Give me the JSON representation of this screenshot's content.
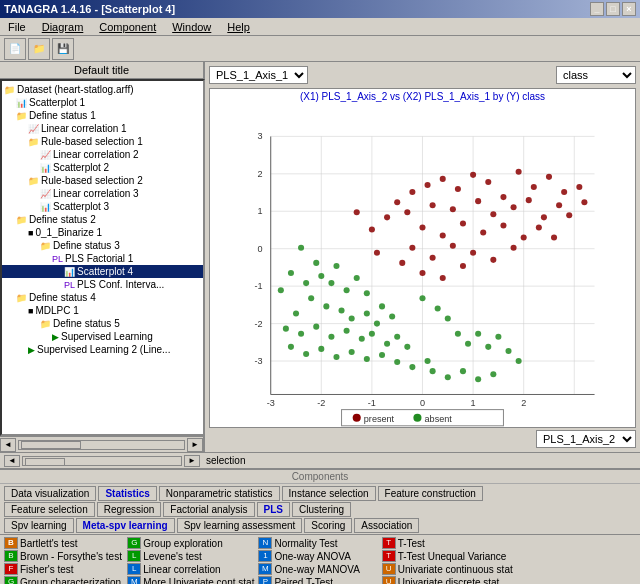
{
  "titleBar": {
    "title": "TANAGRA 1.4.16 - [Scatterplot 4]",
    "buttons": [
      "_",
      "□",
      "×"
    ]
  },
  "menuBar": {
    "items": [
      "File",
      "Diagram",
      "Component",
      "Window",
      "Help"
    ]
  },
  "toolbar": {
    "buttons": [
      "📄",
      "📁",
      "💾",
      "⚙"
    ]
  },
  "leftPanel": {
    "defaultTitle": "Default title",
    "tree": [
      {
        "indent": 0,
        "icon": "📁",
        "label": "Dataset (heart-statlog.arff)",
        "type": "dataset"
      },
      {
        "indent": 1,
        "icon": "📊",
        "label": "Scatterplot 1",
        "type": "plot"
      },
      {
        "indent": 1,
        "icon": "📁",
        "label": "Define status 1",
        "type": "folder"
      },
      {
        "indent": 2,
        "icon": "📈",
        "label": "Linear correlation 1",
        "type": "stat"
      },
      {
        "indent": 2,
        "icon": "📁",
        "label": "Rule-based selection 1",
        "type": "folder"
      },
      {
        "indent": 3,
        "icon": "📈",
        "label": "Linear correlation 2",
        "type": "stat"
      },
      {
        "indent": 3,
        "icon": "📊",
        "label": "Scatterplot 2",
        "type": "plot"
      },
      {
        "indent": 2,
        "icon": "📁",
        "label": "Rule-based selection 2",
        "type": "folder"
      },
      {
        "indent": 3,
        "icon": "📈",
        "label": "Linear correlation 3",
        "type": "stat"
      },
      {
        "indent": 3,
        "icon": "📊",
        "label": "Scatterplot 3",
        "type": "plot"
      },
      {
        "indent": 1,
        "icon": "📁",
        "label": "Define status 2",
        "type": "folder"
      },
      {
        "indent": 2,
        "icon": "📊",
        "label": "0_1_Binarize 1",
        "type": "plot"
      },
      {
        "indent": 3,
        "icon": "📁",
        "label": "Define status 3",
        "type": "folder"
      },
      {
        "indent": 4,
        "icon": "📊",
        "label": "PLS Factorial 1",
        "type": "pls"
      },
      {
        "indent": 5,
        "icon": "📊",
        "label": "Scatterplot 4",
        "type": "plot",
        "selected": true
      },
      {
        "indent": 5,
        "icon": "📊",
        "label": "PLS Conf. Interva...",
        "type": "pls"
      },
      {
        "indent": 1,
        "icon": "📁",
        "label": "Define status 4",
        "type": "folder"
      },
      {
        "indent": 2,
        "icon": "📊",
        "label": "MDLPC 1",
        "type": "mdlpc"
      },
      {
        "indent": 3,
        "icon": "📁",
        "label": "Define status 5",
        "type": "folder"
      },
      {
        "indent": 4,
        "icon": "▶",
        "label": "Supervised Learning",
        "type": "learning"
      },
      {
        "indent": 2,
        "icon": "▶",
        "label": "Supervised Learning 2 (Line...",
        "type": "learning"
      }
    ]
  },
  "plotPanel": {
    "xAxisDropdown": "PLS_1_Axis_1",
    "classDropdown": "class",
    "title": "(X1) PLS_1_Axis_2 vs (X2) PLS_1_Axis_1 by (Y) class",
    "yAxisLabel": "PLS_1_Axis_2",
    "xAxisValues": [
      "-3",
      "-2",
      "-1",
      "0",
      "1",
      "2"
    ],
    "yAxisValues": [
      "3",
      "2",
      "1",
      "0",
      "-1",
      "-2",
      "-3"
    ],
    "legend": {
      "present": "present",
      "absent": "absent"
    }
  },
  "components": {
    "title": "Components",
    "tabs": [
      [
        "Data visualization",
        "Statistics",
        "Nonparametric statistics",
        "Instance selection",
        "Feature construction"
      ],
      [
        "Feature selection",
        "Regression",
        "Factorial analysis",
        "PLS",
        "Clustering"
      ],
      [
        "Spv learning",
        "Meta-spv learning",
        "Spv learning assessment",
        "Scoring",
        "Association"
      ]
    ],
    "stats": [
      {
        "icon": "B",
        "color": "red",
        "label": "Bartlett's test"
      },
      {
        "icon": "G",
        "color": "green",
        "label": "Group exploration"
      },
      {
        "icon": "N",
        "color": "blue",
        "label": "Normality Test"
      },
      {
        "icon": "T",
        "color": "red",
        "label": "T-Test"
      },
      {
        "icon": "",
        "color": "",
        "label": ""
      },
      {
        "icon": "B",
        "color": "green",
        "label": "Brown - Forsythe's test"
      },
      {
        "icon": "L",
        "color": "green",
        "label": "Levene's test"
      },
      {
        "icon": "1",
        "color": "blue",
        "label": "One-way ANOVA"
      },
      {
        "icon": "T",
        "color": "red",
        "label": "T-Test Unequal Variance"
      },
      {
        "icon": "",
        "color": "",
        "label": ""
      },
      {
        "icon": "F",
        "color": "red",
        "label": "Fisher's test"
      },
      {
        "icon": "L",
        "color": "blue",
        "label": "Linear correlation"
      },
      {
        "icon": "M",
        "color": "blue",
        "label": "One-way MANOVA"
      },
      {
        "icon": "U",
        "color": "orange",
        "label": "Univariate continuous stat"
      },
      {
        "icon": "",
        "color": "",
        "label": ""
      },
      {
        "icon": "G",
        "color": "green",
        "label": "Group characterization"
      },
      {
        "icon": "M",
        "color": "blue",
        "label": "More Univariate cont stat"
      },
      {
        "icon": "P",
        "color": "blue",
        "label": "Paired T-Test"
      },
      {
        "icon": "U",
        "color": "orange",
        "label": "Univariate discrete stat"
      },
      {
        "icon": "",
        "color": "",
        "label": ""
      }
    ]
  }
}
